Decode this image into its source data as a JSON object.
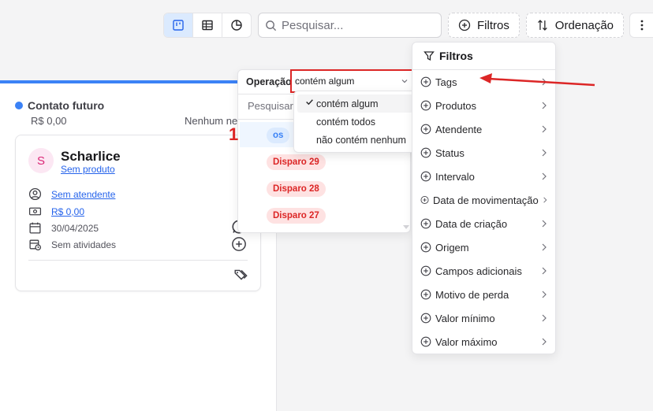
{
  "toolbar": {
    "view_buttons": [
      "kanban-icon",
      "table-icon",
      "chart-pie-icon"
    ],
    "active_view": "kanban",
    "search_placeholder": "Pesquisar...",
    "filters_label": "Filtros",
    "sort_label": "Ordenação"
  },
  "column": {
    "title": "Contato futuro",
    "value": "R$ 0,00",
    "right_text": "Nenhum neg",
    "accent": "#3b82f6"
  },
  "card": {
    "avatar_letter": "S",
    "name": "Scharlice",
    "product": "Sem produto",
    "attendant": "Sem atendente",
    "value": "R$ 0,00",
    "date": "30/04/2025",
    "activities": "Sem atividades"
  },
  "operation_popover": {
    "label": "Operação",
    "selected": "contém algum",
    "search_placeholder": "Pesquisar...",
    "options": [
      "contém algum",
      "contém todos",
      "não contém nenhum"
    ],
    "chips": [
      {
        "label": "os",
        "color": "blue"
      },
      {
        "label": "Disparo 29",
        "color": "red"
      },
      {
        "label": "Disparo 28",
        "color": "red"
      },
      {
        "label": "Disparo 27",
        "color": "red"
      }
    ],
    "marker": "1"
  },
  "filters_popover": {
    "title": "Filtros",
    "items": [
      "Tags",
      "Produtos",
      "Atendente",
      "Status",
      "Intervalo",
      "Data de movimentação",
      "Data de criação",
      "Origem",
      "Campos adicionais",
      "Motivo de perda",
      "Valor mínimo",
      "Valor máximo"
    ]
  }
}
